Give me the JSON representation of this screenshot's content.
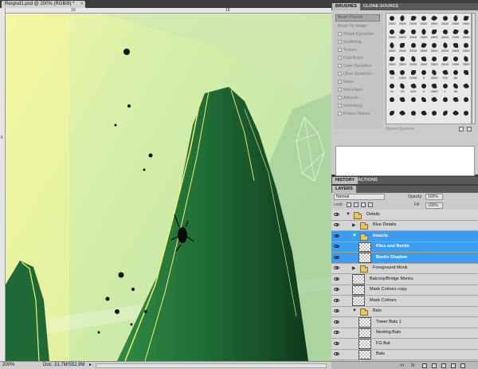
{
  "document": {
    "tab_title": "Respsd1.psd @ 200% (RGB/8) *",
    "close_glyph": "×",
    "ruler_h_marks": [
      "10",
      "18"
    ],
    "ruler_v_marks": [
      "6"
    ],
    "zoom": "200%",
    "doc_info": "Doc: 31.7M/552.9M",
    "status_arrow": "▸"
  },
  "brushes_panel": {
    "tabs": [
      "BRUSHES",
      "CLONE SOURCE"
    ],
    "preset_button": "Brush Presets",
    "options": [
      {
        "label": "Brush Tip Shape",
        "checkbox": false
      },
      {
        "label": "Shape Dynamics",
        "checkbox": true
      },
      {
        "label": "Scattering",
        "checkbox": true
      },
      {
        "label": "Texture",
        "checkbox": true
      },
      {
        "label": "Dual Brush",
        "checkbox": true
      },
      {
        "label": "Color Dynamics",
        "checkbox": true
      },
      {
        "label": "Other Dynamics",
        "checkbox": true
      },
      {
        "label": "Noise",
        "checkbox": true
      },
      {
        "label": "Wet Edges",
        "checkbox": true
      },
      {
        "label": "Airbrush",
        "checkbox": true
      },
      {
        "label": "Smoothing",
        "checkbox": true
      },
      {
        "label": "Protect Texture",
        "checkbox": true
      }
    ],
    "brush_sizes": [
      "2500",
      "2500",
      "2500",
      "2500",
      "2500",
      "2500",
      "2500",
      "2500",
      "2500",
      "2500",
      "2500",
      "2500",
      "2500",
      "2500",
      "2500",
      "2500",
      "2500",
      "2500",
      "2500",
      "2500",
      "2500",
      "2500",
      "2500",
      "2500",
      "2500",
      "2500",
      "2500",
      "2500",
      "2500",
      "2500",
      "2500",
      "2500",
      "17",
      "2452",
      "2459",
      "5",
      "2500",
      "700",
      "80",
      "",
      "12",
      "25",
      "400",
      "3",
      "2500",
      "1",
      "50",
      "",
      "",
      "",
      "",
      "",
      "",
      "",
      "",
      "",
      "",
      "",
      "",
      "",
      "",
      "",
      "",
      ""
    ],
    "diameter_label": "Master Diameter"
  },
  "history_panel": {
    "tabs": [
      "HISTORY",
      "ACTIONS"
    ]
  },
  "layers_panel": {
    "tab": "LAYERS",
    "blend_mode": "Normal",
    "opacity_label": "Opacity:",
    "opacity_value": "100%",
    "lock_label": "Lock:",
    "fill_label": "Fill:",
    "fill_value": "100%",
    "layers": [
      {
        "name": "Details",
        "kind": "group",
        "indent": 0,
        "expanded": true,
        "selected": false
      },
      {
        "name": "Blue Details",
        "kind": "group",
        "indent": 1,
        "expanded": false,
        "selected": false
      },
      {
        "name": "Insects",
        "kind": "group",
        "indent": 1,
        "expanded": true,
        "selected": true
      },
      {
        "name": "Flies and Beetle",
        "kind": "layer",
        "indent": 2,
        "selected": true
      },
      {
        "name": "Beetle Shadow",
        "kind": "layer",
        "indent": 2,
        "selected": true
      },
      {
        "name": "Foreground Monk",
        "kind": "group",
        "indent": 1,
        "expanded": false,
        "selected": false
      },
      {
        "name": "Balcony/Bridge Monks",
        "kind": "layer",
        "indent": 1,
        "selected": false
      },
      {
        "name": "Mask Colours copy",
        "kind": "layer",
        "indent": 1,
        "selected": false
      },
      {
        "name": "Mask Colours",
        "kind": "layer",
        "indent": 1,
        "selected": false
      },
      {
        "name": "Bats",
        "kind": "group",
        "indent": 1,
        "expanded": true,
        "selected": false
      },
      {
        "name": "Tower Bats 1",
        "kind": "layer",
        "indent": 2,
        "selected": false
      },
      {
        "name": "Nesting Bats",
        "kind": "layer",
        "indent": 2,
        "selected": false
      },
      {
        "name": "FG Bat",
        "kind": "layer",
        "indent": 2,
        "selected": false
      },
      {
        "name": "Bats",
        "kind": "layer",
        "indent": 2,
        "selected": false
      }
    ],
    "footer_link": "∞",
    "fx": "fx"
  },
  "colors": {
    "selection_blue": "#3c9cf1",
    "canvas_bg": "#d8ef9a",
    "rock_green": "#2e7a3c",
    "panel_gray": "#cbcbcb"
  }
}
